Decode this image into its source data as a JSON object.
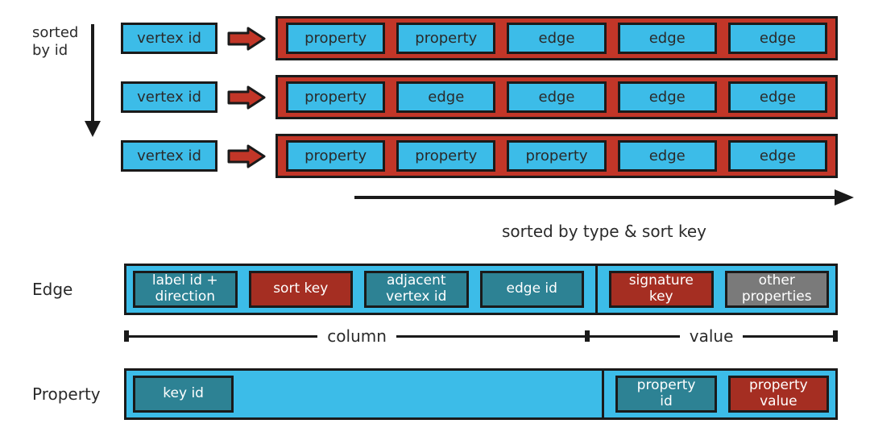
{
  "top": {
    "sorted_label_line1": "sorted",
    "sorted_label_line2": "by id",
    "rows": [
      {
        "vertex": "vertex id",
        "cells": [
          "property",
          "property",
          "edge",
          "edge",
          "edge"
        ]
      },
      {
        "vertex": "vertex id",
        "cells": [
          "property",
          "edge",
          "edge",
          "edge",
          "edge"
        ]
      },
      {
        "vertex": "vertex id",
        "cells": [
          "property",
          "property",
          "property",
          "edge",
          "edge"
        ]
      }
    ],
    "h_arrow_label": "sorted by type & sort key"
  },
  "edge": {
    "label": "Edge",
    "cells": [
      {
        "text": "label id +\ndirection",
        "color": "teal"
      },
      {
        "text": "sort key",
        "color": "red"
      },
      {
        "text": "adjacent\nvertex  id",
        "color": "teal"
      },
      {
        "text": "edge id",
        "color": "teal"
      },
      {
        "sep": true
      },
      {
        "text": "signature\nkey",
        "color": "red"
      },
      {
        "text": "other\nproperties",
        "color": "gray"
      }
    ]
  },
  "colval": {
    "column": "column",
    "value": "value"
  },
  "property": {
    "label": "Property",
    "cells": [
      {
        "text": "key id",
        "color": "teal",
        "w": 1
      },
      {
        "spacer": true
      },
      {
        "sep": true
      },
      {
        "text": "property\nid",
        "color": "teal",
        "w": 1
      },
      {
        "text": "property\nvalue",
        "color": "red",
        "w": 1
      }
    ]
  }
}
